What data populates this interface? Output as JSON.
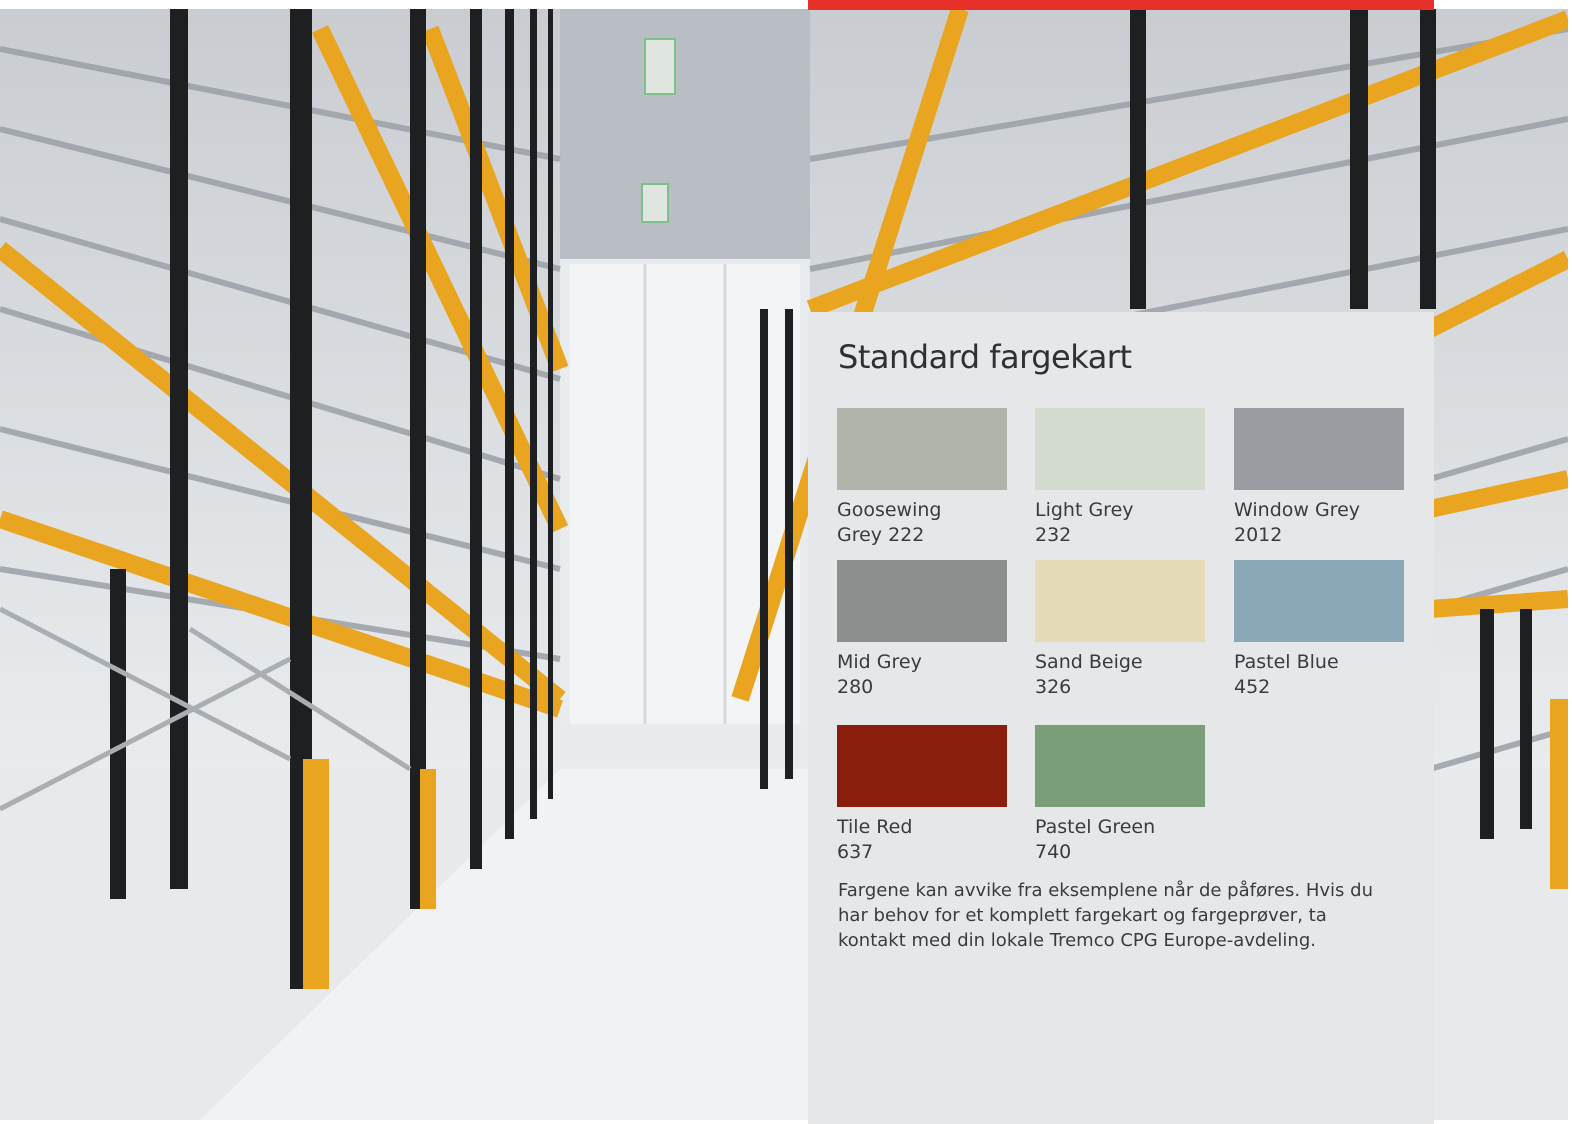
{
  "page": {
    "title": "Standard fargekart",
    "note": "Fargene kan avvike fra eksemplene når de påføres. Hvis du har behov for et komplett fargekart og fargeprøver, ta kontakt med din lokale Tremco CPG Europe-avdeling."
  },
  "colors": {
    "accent_bar": "#e8302a",
    "panel_bg": "#e6e7e9",
    "rack_orange": "#e9a520",
    "rack_black": "#1e1f21"
  },
  "swatches": [
    {
      "name": "Goosewing",
      "code": "Grey 222",
      "color": "#b1b4ab"
    },
    {
      "name": "Light Grey",
      "code": "232",
      "color": "#d3dbcf"
    },
    {
      "name": "Window Grey",
      "code": "2012",
      "color": "#999da2"
    },
    {
      "name": "Mid Grey",
      "code": "280",
      "color": "#8b8f8e"
    },
    {
      "name": "Sand Beige",
      "code": "326",
      "color": "#e6dbb9"
    },
    {
      "name": "Pastel Blue",
      "code": "452",
      "color": "#8aa8b8"
    },
    {
      "name": "Tile Red",
      "code": "637",
      "color": "#8a1e0d"
    },
    {
      "name": "Pastel Green",
      "code": "740",
      "color": "#7a9e77"
    }
  ]
}
